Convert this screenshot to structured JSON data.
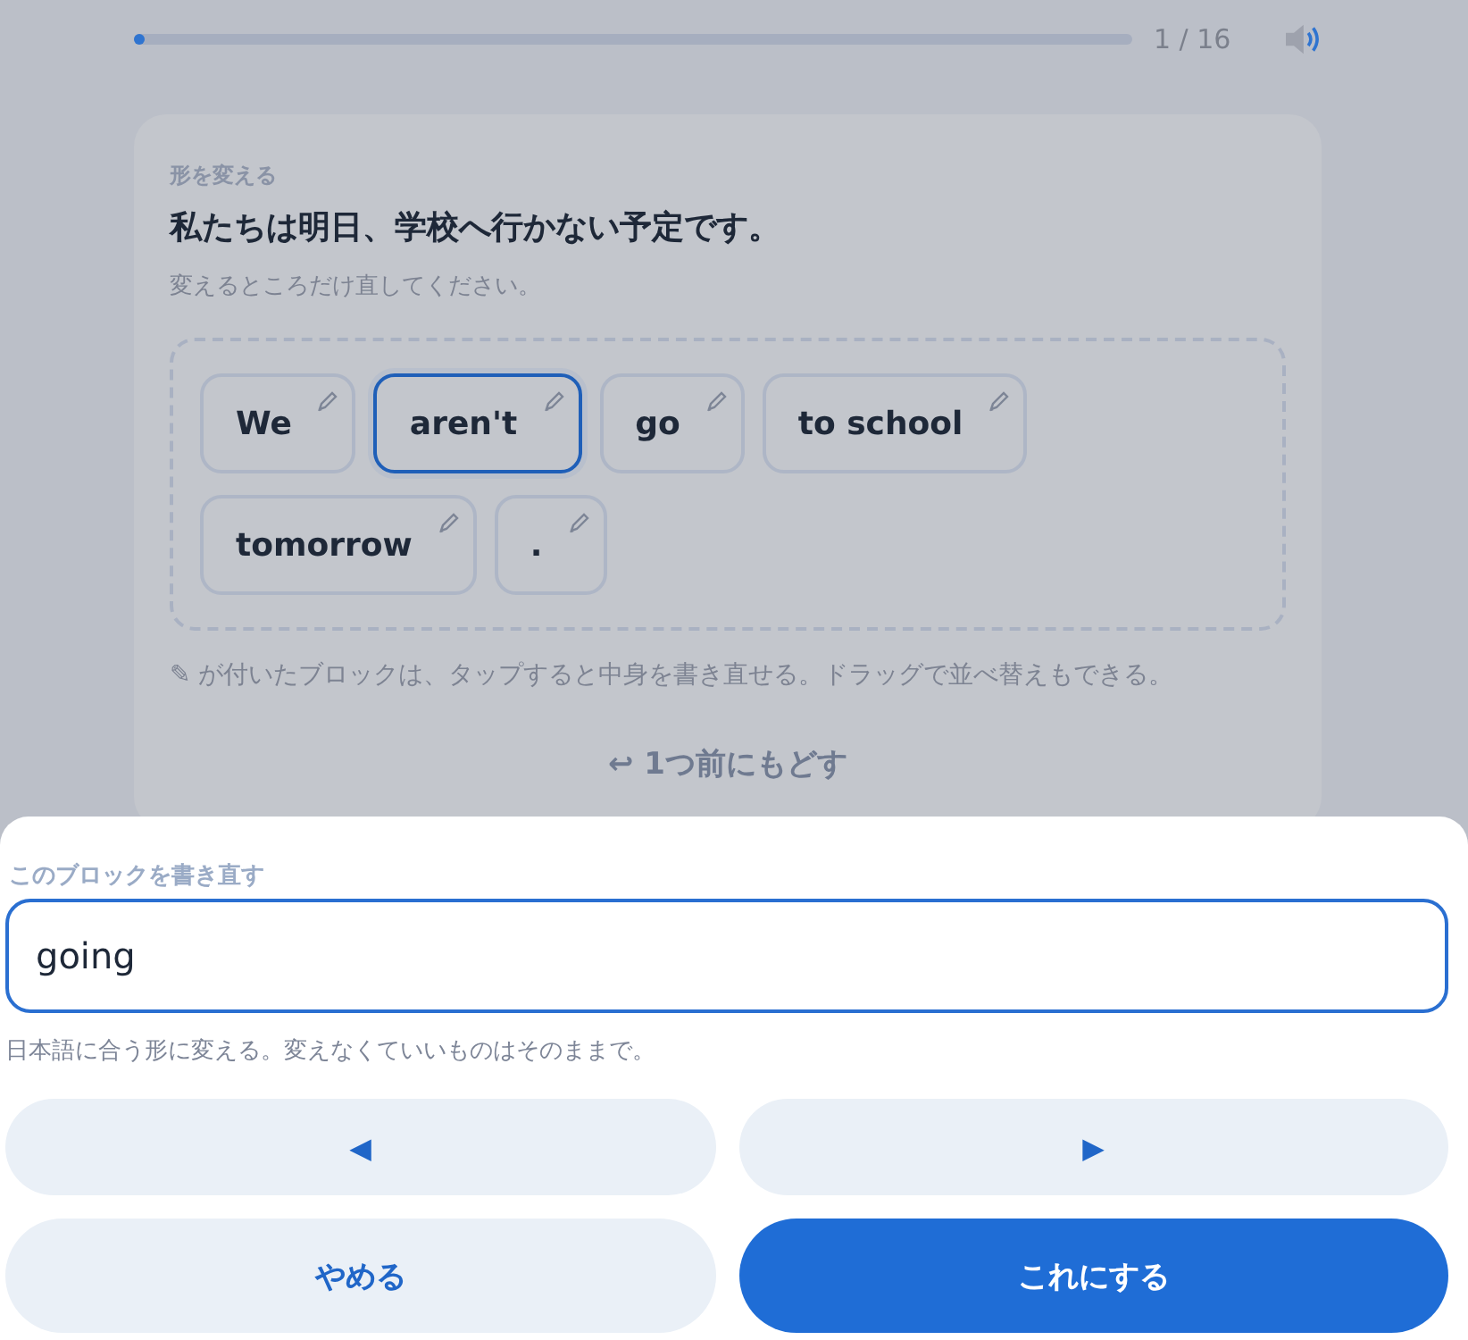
{
  "progress": {
    "counter": "1 / 16",
    "level": 0
  },
  "card": {
    "category": "形を変える",
    "sentence": "私たちは明日、学校へ行かない予定です。",
    "instruction": "変えるところだけ直してください。",
    "blocks": [
      {
        "text": "We",
        "editable": true,
        "selected": false
      },
      {
        "text": "aren't",
        "editable": true,
        "selected": true
      },
      {
        "text": "go",
        "editable": true,
        "selected": false
      },
      {
        "text": "to school",
        "editable": true,
        "selected": false
      },
      {
        "text": "tomorrow",
        "editable": true,
        "selected": false
      },
      {
        "text": ".",
        "editable": true,
        "selected": false
      }
    ],
    "hint": "✎ が付いたブロックは、タップすると中身を書き直せる。ドラッグで並べ替えもできる。",
    "undo": "↩ 1つ前にもどす"
  },
  "sheet": {
    "label": "このブロックを書き直す",
    "value": "going",
    "hint": "日本語に合う形に変える。変えなくていいものはそのままで。",
    "nav_buttons": [
      "◀",
      "▶"
    ],
    "actions": [
      {
        "label": "やめる",
        "kind": "secondary"
      },
      {
        "label": "これにする",
        "kind": "primary"
      }
    ]
  }
}
